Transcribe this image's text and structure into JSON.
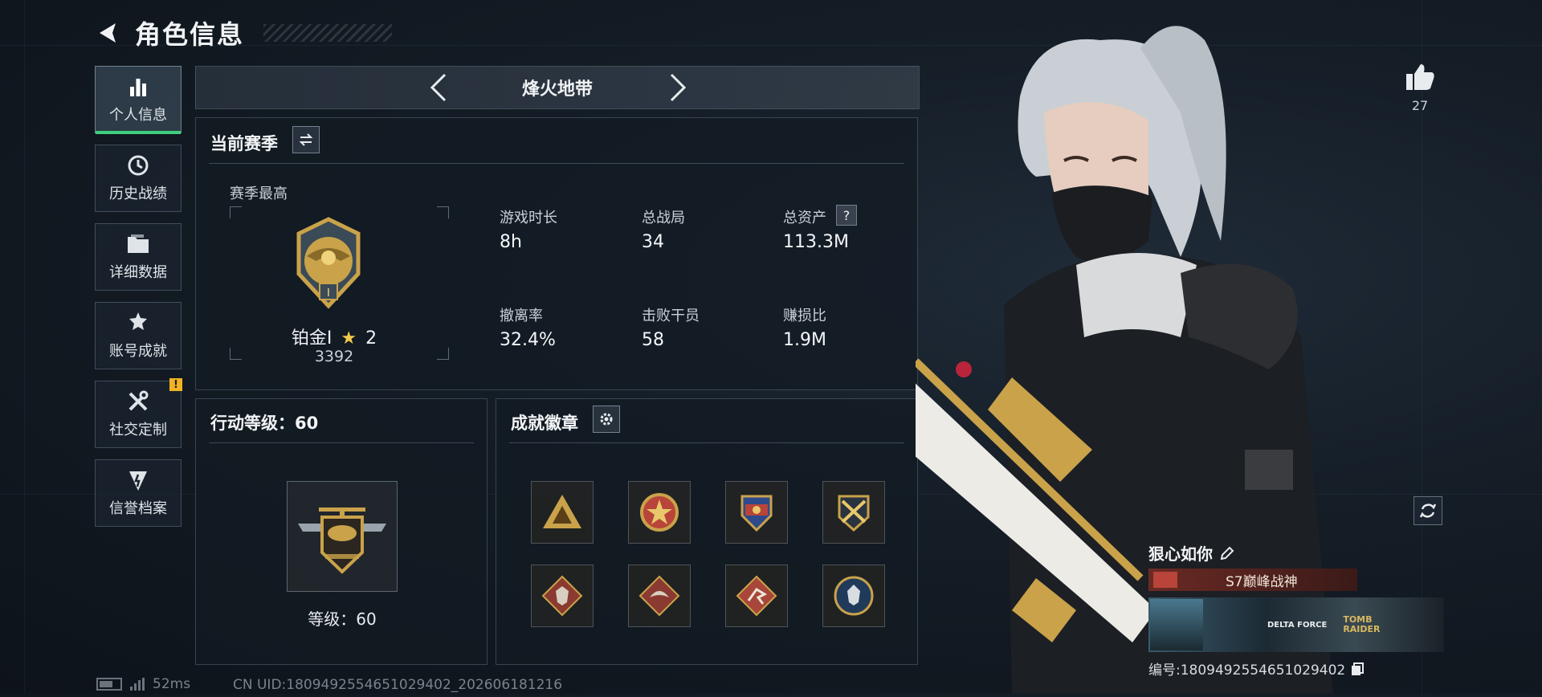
{
  "header": {
    "title": "角色信息"
  },
  "sidebar": {
    "items": [
      {
        "label": "个人信息",
        "icon": "bar-chart-icon",
        "active": true
      },
      {
        "label": "历史战绩",
        "icon": "history-clock-icon"
      },
      {
        "label": "详细数据",
        "icon": "folder-icon"
      },
      {
        "label": "账号成就",
        "icon": "achievement-icon"
      },
      {
        "label": "社交定制",
        "icon": "tools-icon",
        "badge": "!"
      },
      {
        "label": "信誉档案",
        "icon": "reputation-icon"
      }
    ]
  },
  "mode": {
    "title": "烽火地带"
  },
  "season": {
    "title": "当前赛季",
    "best_label": "赛季最高",
    "rank_name": "铂金Ⅰ",
    "rank_stars": "2",
    "rank_score": "3392",
    "rank_emblem_numeral": "Ⅰ",
    "stats": [
      {
        "label": "游戏时长",
        "value": "8h"
      },
      {
        "label": "总战局",
        "value": "34"
      },
      {
        "label": "总资产",
        "value": "113.3M",
        "help": "?"
      },
      {
        "label": "撤离率",
        "value": "32.4%"
      },
      {
        "label": "击败干员",
        "value": "58"
      },
      {
        "label": "赚损比",
        "value": "1.9M"
      }
    ]
  },
  "action_level": {
    "title": "行动等级：60",
    "level_text": "等级：60"
  },
  "achievements": {
    "title": "成就徽章"
  },
  "likes": {
    "count": "27"
  },
  "player_card": {
    "name": "狠心如你",
    "title_tag": "S7巅峰战神",
    "banner_brand_1": "DELTA FORCE",
    "banner_brand_2": "TOMB RAIDER",
    "id_text": "编号:1809492554651029402"
  },
  "footer": {
    "ping": "52ms",
    "uid": "CN UID:1809492554651029402_202606181216"
  },
  "colors": {
    "accent_green": "#3ecf7c",
    "notify_yellow": "#f0b323",
    "gold": "#c9a24a"
  }
}
